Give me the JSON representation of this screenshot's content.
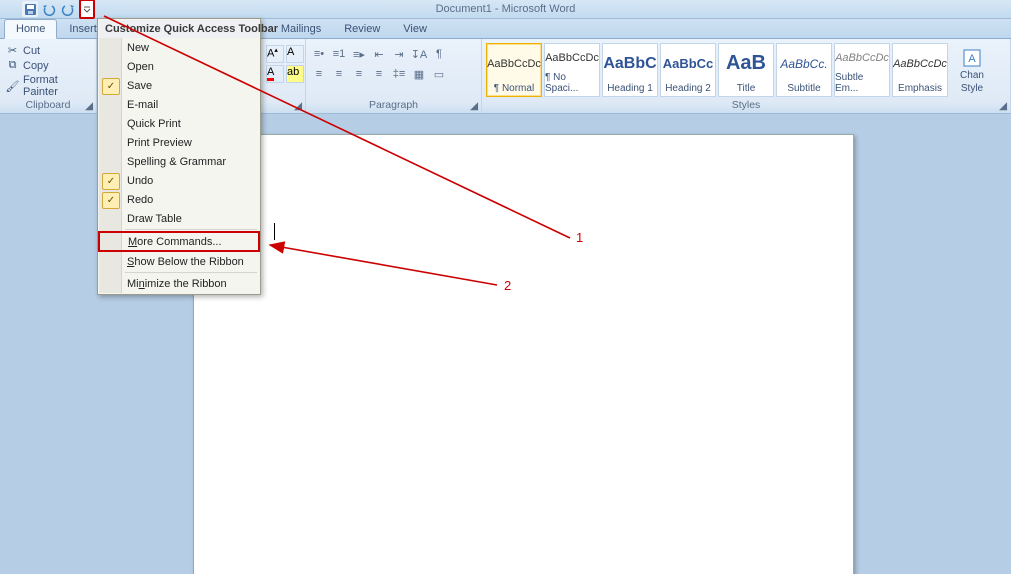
{
  "window": {
    "title": "Document1 - Microsoft Word"
  },
  "tabs": {
    "home": "Home",
    "insert": "Insert",
    "mailings": "Mailings",
    "review": "Review",
    "view": "View"
  },
  "clipboard": {
    "title": "Clipboard",
    "cut": "Cut",
    "copy": "Copy",
    "format_painter": "Format Painter"
  },
  "paragraph": {
    "title": "Paragraph"
  },
  "styles": {
    "title": "Styles",
    "change_styles_line1": "Chan",
    "change_styles_line2": "Style",
    "tiles": [
      {
        "sample": "AaBbCcDc",
        "label": "¶ Normal",
        "color": "#333",
        "size": "11px",
        "face": "normal"
      },
      {
        "sample": "AaBbCcDc",
        "label": "¶ No Spaci...",
        "color": "#333",
        "size": "11px",
        "face": "normal"
      },
      {
        "sample": "AaBbC",
        "label": "Heading 1",
        "color": "#2f5496",
        "size": "16px",
        "face": "bold"
      },
      {
        "sample": "AaBbCc",
        "label": "Heading 2",
        "color": "#2f5496",
        "size": "13px",
        "face": "bold"
      },
      {
        "sample": "AaB",
        "label": "Title",
        "color": "#2f5496",
        "size": "20px",
        "face": "bold"
      },
      {
        "sample": "AaBbCc.",
        "label": "Subtitle",
        "color": "#2f5496",
        "size": "12px",
        "face": "italic"
      },
      {
        "sample": "AaBbCcDc",
        "label": "Subtle Em...",
        "color": "#808080",
        "size": "11px",
        "face": "italic"
      },
      {
        "sample": "AaBbCcDc",
        "label": "Emphasis",
        "color": "#333",
        "size": "11px",
        "face": "italic"
      }
    ]
  },
  "qat_menu": {
    "title": "Customize Quick Access Toolbar",
    "items": [
      {
        "label": "New",
        "checked": false
      },
      {
        "label": "Open",
        "checked": false
      },
      {
        "label": "Save",
        "checked": true
      },
      {
        "label": "E-mail",
        "checked": false
      },
      {
        "label": "Quick Print",
        "checked": false
      },
      {
        "label": "Print Preview",
        "checked": false
      },
      {
        "label": "Spelling & Grammar",
        "checked": false
      },
      {
        "label": "Undo",
        "checked": true
      },
      {
        "label": "Redo",
        "checked": true
      },
      {
        "label": "Draw Table",
        "checked": false
      }
    ],
    "more_commands_html": "<span class='underline-s'>M</span>ore Commands...",
    "show_below_html": "<span class='underline-s'>S</span>how Below the Ribbon",
    "minimize_html": "Mi<span class='underline-s'>n</span>imize the Ribbon"
  },
  "annotations": {
    "label1": "1",
    "label2": "2"
  }
}
